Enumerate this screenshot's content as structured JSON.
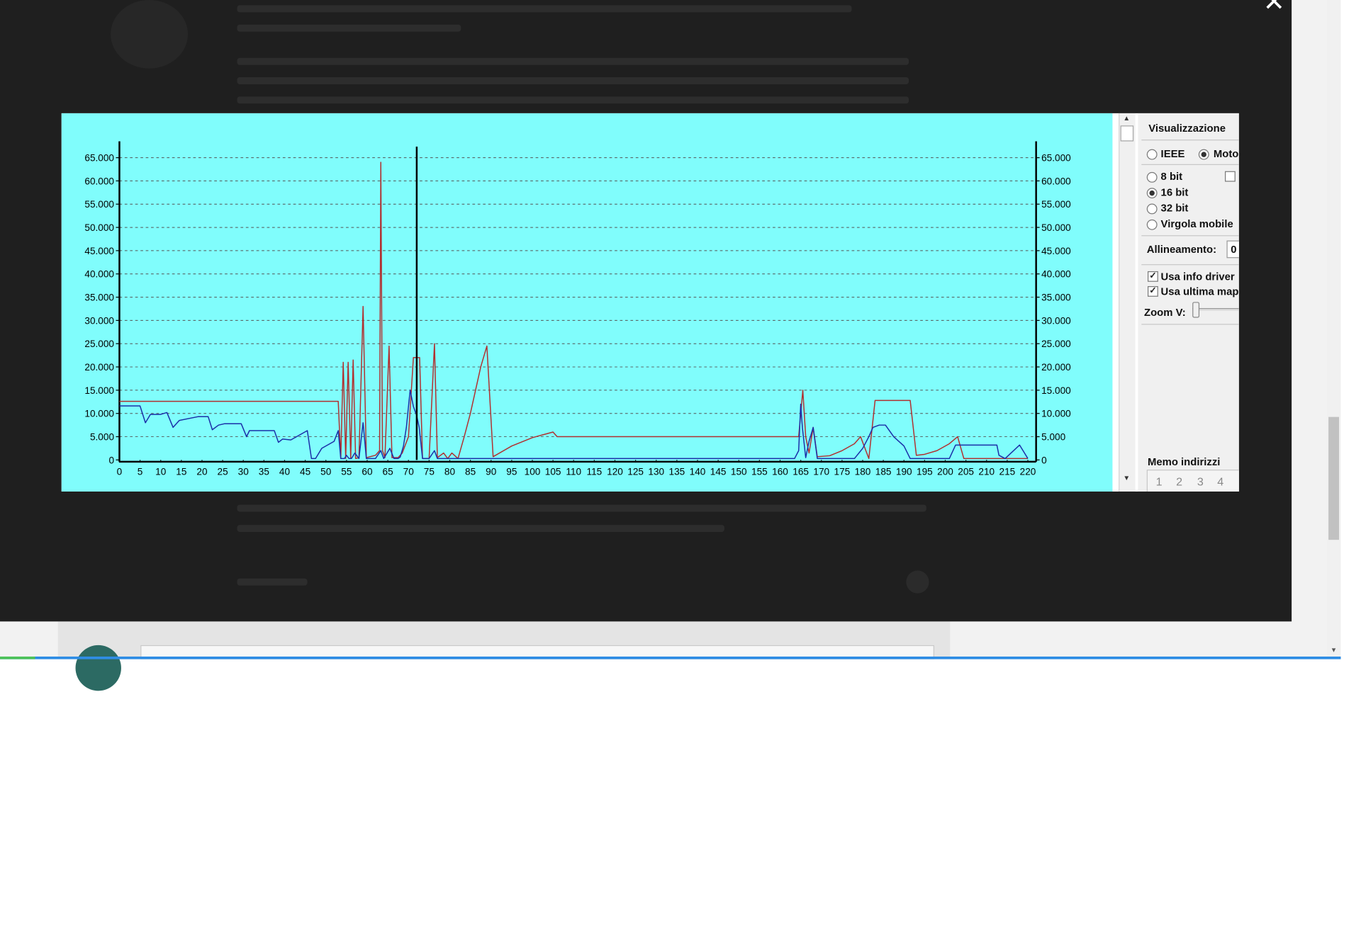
{
  "overlay": {
    "close_label": "✕"
  },
  "panel": {
    "title": "Visualizzazione",
    "endian": [
      {
        "label": "IEEE",
        "selected": false
      },
      {
        "label": "Moto",
        "selected": true
      }
    ],
    "sizes": [
      {
        "label": "8 bit",
        "selected": false
      },
      {
        "label": "16 bit",
        "selected": true
      },
      {
        "label": "32 bit",
        "selected": false
      },
      {
        "label": "Virgola mobile",
        "selected": false
      }
    ],
    "alignment_label": "Allineamento:",
    "alignment_value": "0",
    "options": [
      {
        "label": "Usa info driver",
        "checked": true
      },
      {
        "label": "Usa ultima map",
        "checked": true
      }
    ],
    "zoom_label": "Zoom V:",
    "memo_title": "Memo indirizzi",
    "memo_buttons": [
      "1",
      "2",
      "3",
      "4"
    ]
  },
  "chart_data": {
    "type": "line",
    "x_ticks": [
      0,
      5,
      10,
      15,
      20,
      25,
      30,
      35,
      40,
      45,
      50,
      55,
      60,
      65,
      70,
      75,
      80,
      85,
      90,
      95,
      100,
      105,
      110,
      115,
      120,
      125,
      130,
      135,
      140,
      145,
      150,
      155,
      160,
      165,
      170,
      175,
      180,
      185,
      190,
      195,
      200,
      205,
      210,
      215,
      220
    ],
    "y_ticks": [
      "0",
      "5.000",
      "10.000",
      "15.000",
      "20.000",
      "25.000",
      "30.000",
      "35.000",
      "40.000",
      "45.000",
      "50.000",
      "55.000",
      "60.000",
      "65.000"
    ],
    "xlim": [
      0,
      222
    ],
    "ylim": [
      0,
      67000
    ],
    "grid": true,
    "background": "#80fdfc",
    "cursor_x": 72,
    "series": [
      {
        "color": "#b03030",
        "points": [
          [
            0,
            12600
          ],
          [
            53,
            12600
          ],
          [
            53.6,
            300
          ],
          [
            54.2,
            21000
          ],
          [
            54.8,
            300
          ],
          [
            55.4,
            21000
          ],
          [
            56,
            300
          ],
          [
            56.6,
            21500
          ],
          [
            57.2,
            300
          ],
          [
            58,
            500
          ],
          [
            59,
            33000
          ],
          [
            59.8,
            500
          ],
          [
            62,
            1000
          ],
          [
            63,
            2000
          ],
          [
            63.3,
            64000
          ],
          [
            63.7,
            2000
          ],
          [
            64.3,
            500
          ],
          [
            65.3,
            24500
          ],
          [
            66,
            500
          ],
          [
            67.5,
            500
          ],
          [
            68.5,
            1500
          ],
          [
            70,
            5000
          ],
          [
            71.2,
            22000
          ],
          [
            72.7,
            22000
          ],
          [
            73.4,
            300
          ],
          [
            75,
            300
          ],
          [
            76.3,
            25000
          ],
          [
            77,
            500
          ],
          [
            78.5,
            1500
          ],
          [
            79.5,
            300
          ],
          [
            80.5,
            1500
          ],
          [
            82,
            300
          ],
          [
            83.5,
            5000
          ],
          [
            85,
            10000
          ],
          [
            87.5,
            20000
          ],
          [
            89,
            24500
          ],
          [
            90.5,
            700
          ],
          [
            95,
            3000
          ],
          [
            100,
            4800
          ],
          [
            105,
            6000
          ],
          [
            106,
            5000
          ],
          [
            163.5,
            5000
          ],
          [
            164.5,
            5000
          ],
          [
            165.5,
            15000
          ],
          [
            166.2,
            5000
          ],
          [
            167,
            1500
          ],
          [
            168,
            7000
          ],
          [
            169,
            700
          ],
          [
            172,
            900
          ],
          [
            175,
            2000
          ],
          [
            178,
            3500
          ],
          [
            179.5,
            5000
          ],
          [
            181.5,
            300
          ],
          [
            183,
            12800
          ],
          [
            191.5,
            12800
          ],
          [
            193,
            1000
          ],
          [
            195,
            1200
          ],
          [
            198,
            2000
          ],
          [
            201,
            3500
          ],
          [
            203,
            5000
          ],
          [
            204.5,
            300
          ],
          [
            220,
            300
          ]
        ]
      },
      {
        "color": "#1a2ea8",
        "points": [
          [
            0,
            11600
          ],
          [
            5,
            11600
          ],
          [
            6.3,
            8000
          ],
          [
            7.5,
            9800
          ],
          [
            10,
            9800
          ],
          [
            11.5,
            10200
          ],
          [
            13,
            7000
          ],
          [
            14.5,
            8500
          ],
          [
            19,
            9300
          ],
          [
            21.5,
            9300
          ],
          [
            22.5,
            6500
          ],
          [
            24,
            7500
          ],
          [
            25.5,
            7800
          ],
          [
            29.5,
            7800
          ],
          [
            30.8,
            5000
          ],
          [
            31.5,
            6300
          ],
          [
            37.5,
            6300
          ],
          [
            38.5,
            3800
          ],
          [
            39.5,
            4500
          ],
          [
            41.5,
            4300
          ],
          [
            45.5,
            6300
          ],
          [
            46.5,
            300
          ],
          [
            47.5,
            300
          ],
          [
            49,
            2500
          ],
          [
            52,
            4000
          ],
          [
            53,
            6300
          ],
          [
            53.6,
            300
          ],
          [
            54.5,
            300
          ],
          [
            55,
            1000
          ],
          [
            55.6,
            300
          ],
          [
            56.2,
            300
          ],
          [
            57,
            1500
          ],
          [
            58,
            300
          ],
          [
            59,
            8000
          ],
          [
            59.8,
            300
          ],
          [
            62,
            300
          ],
          [
            63.3,
            2000
          ],
          [
            64,
            300
          ],
          [
            65.5,
            2500
          ],
          [
            66.5,
            300
          ],
          [
            67.5,
            300
          ],
          [
            68,
            600
          ],
          [
            68.8,
            3000
          ],
          [
            69.5,
            7000
          ],
          [
            70.4,
            15000
          ],
          [
            71.2,
            11500
          ],
          [
            72,
            9500
          ],
          [
            72.6,
            7000
          ],
          [
            73.4,
            300
          ],
          [
            75,
            300
          ],
          [
            76.3,
            2000
          ],
          [
            77,
            300
          ],
          [
            80,
            300
          ],
          [
            81,
            300
          ],
          [
            163.5,
            300
          ],
          [
            164.5,
            2000
          ],
          [
            165,
            12000
          ],
          [
            165.4,
            7000
          ],
          [
            166.2,
            500
          ],
          [
            167,
            4000
          ],
          [
            168,
            7000
          ],
          [
            169,
            300
          ],
          [
            172,
            300
          ],
          [
            178,
            300
          ],
          [
            180,
            2500
          ],
          [
            181.5,
            5000
          ],
          [
            182.5,
            7000
          ],
          [
            184,
            7500
          ],
          [
            185.5,
            7500
          ],
          [
            187.5,
            5000
          ],
          [
            190,
            3000
          ],
          [
            191.5,
            300
          ],
          [
            196,
            300
          ],
          [
            201,
            300
          ],
          [
            202.5,
            3200
          ],
          [
            204,
            3200
          ],
          [
            212.5,
            3200
          ],
          [
            213,
            1000
          ],
          [
            214.5,
            300
          ],
          [
            218,
            3200
          ],
          [
            220,
            300
          ]
        ]
      }
    ]
  }
}
